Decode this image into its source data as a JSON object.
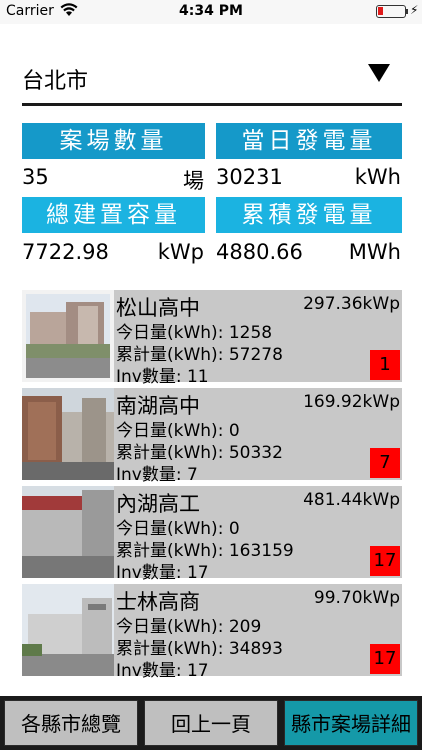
{
  "status_bar": {
    "carrier": "Carrier",
    "time": "4:34 PM"
  },
  "city_select": {
    "value": "台北市",
    "icon": "dropdown-triangle-icon"
  },
  "summary": {
    "site_count": {
      "label": "案場數量",
      "value": "35",
      "unit": "場"
    },
    "daily_power": {
      "label": "當日發電量",
      "value": "30231",
      "unit": "kWh"
    },
    "total_capacity": {
      "label": "總建置容量",
      "value": "7722.98",
      "unit": "kWp"
    },
    "cumulative_power": {
      "label": "累積發電量",
      "value": "4880.66",
      "unit": "MWh"
    }
  },
  "sites": [
    {
      "name": "松山高中",
      "capacity": "297.36kWp",
      "today": "今日量(kWh): 1258",
      "total": "累計量(kWh): 57278",
      "inv": "Inv數量: 11",
      "badge": "1"
    },
    {
      "name": "南湖高中",
      "capacity": "169.92kWp",
      "today": "今日量(kWh): 0",
      "total": "累計量(kWh): 50332",
      "inv": "Inv數量: 7",
      "badge": "7"
    },
    {
      "name": "內湖高工",
      "capacity": "481.44kWp",
      "today": "今日量(kWh): 0",
      "total": "累計量(kWh): 163159",
      "inv": "Inv數量: 17",
      "badge": "17"
    },
    {
      "name": "士林高商",
      "capacity": "99.70kWp",
      "today": "今日量(kWh): 209",
      "total": "累計量(kWh): 34893",
      "inv": "Inv數量: 17",
      "badge": "17"
    }
  ],
  "bottom_nav": {
    "overview": "各縣市總覽",
    "back": "回上一頁",
    "detail": "縣市案場詳細"
  },
  "colors": {
    "header_dark": "#1599c9",
    "header_light": "#1bb3e1",
    "badge": "#ff0000",
    "active_tab": "#1599a8"
  }
}
